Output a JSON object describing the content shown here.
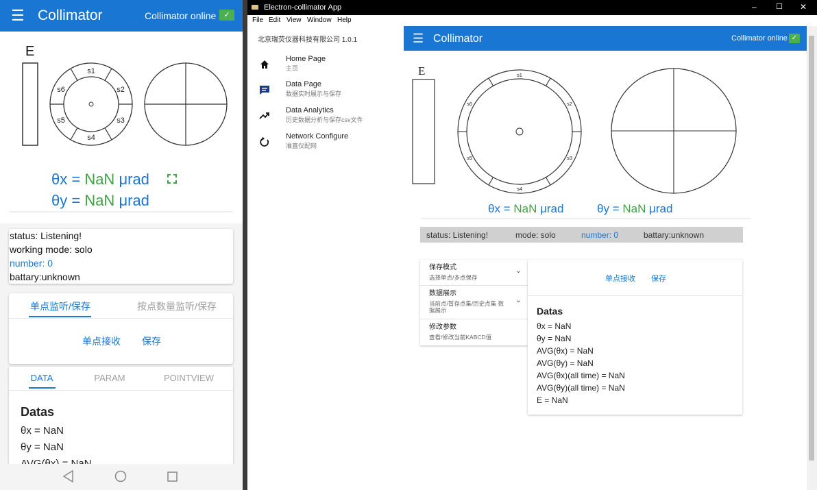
{
  "phone": {
    "appbar": {
      "title": "Collimator",
      "online_label": "Collimator online",
      "check": "✓"
    },
    "diagram": {
      "e_label": "E",
      "sectors": [
        "s1",
        "s2",
        "s3",
        "s4",
        "s5",
        "s6"
      ]
    },
    "theta_x": {
      "label": "θx = ",
      "value": "NaN",
      "unit": " μrad"
    },
    "theta_y": {
      "label": "θy = ",
      "value": "NaN",
      "unit": " μrad"
    },
    "status": {
      "status": "status: Listening!",
      "mode": "working mode: solo",
      "number": "number: 0",
      "battery": "battary:unknown"
    },
    "tabs1": {
      "labels": [
        "单点监听/保存",
        "按点数量监听/保存"
      ],
      "actions": [
        "单点接收",
        "保存"
      ]
    },
    "tabs2": {
      "labels": [
        "DATA",
        "PARAM",
        "POINTVIEW"
      ]
    },
    "datas": {
      "title": "Datas",
      "lines": [
        "θx = NaN",
        "θy = NaN",
        "AVG(θx) = NaN"
      ]
    }
  },
  "window": {
    "title": "Electron-collimator App",
    "controls": [
      "–",
      "☐",
      "✕"
    ],
    "menu": [
      "File",
      "Edit",
      "View",
      "Window",
      "Help"
    ],
    "drawer": {
      "company": "北京瑞荧仪器科技有限公司 1.0.1",
      "items": [
        {
          "icon": "home-icon",
          "glyph": "⌂",
          "label": "Home Page",
          "sub": "主页"
        },
        {
          "icon": "chat-icon",
          "glyph": "▬",
          "label": "Data Page",
          "sub": "数据实时展示与保存"
        },
        {
          "icon": "trending-up-icon",
          "glyph": "↗",
          "label": "Data Analytics",
          "sub": "历史数据分析与保存csv文件"
        },
        {
          "icon": "refresh-icon",
          "glyph": "↻",
          "label": "Network Configure",
          "sub": "准直仪配网"
        }
      ],
      "active_index": 1
    },
    "appbar": {
      "title": "Collimator",
      "online_label": "Collimator online",
      "check": "✓"
    },
    "diagram": {
      "e_label": "E",
      "sectors": [
        "s1",
        "s2",
        "s3",
        "s4",
        "s5",
        "s6"
      ]
    },
    "theta_x": {
      "label": "θx = ",
      "value": "NaN",
      "unit": " μrad"
    },
    "theta_y": {
      "label": "θy = ",
      "value": "NaN",
      "unit": " μrad"
    },
    "status": {
      "status": "status: Listening!",
      "mode": "mode: solo",
      "number": "number: 0",
      "battery": "battary:unknown"
    },
    "panels": [
      {
        "title": "保存模式",
        "sub": "选择单点/多点保存",
        "chevron": "⌄"
      },
      {
        "title": "数据展示",
        "sub": "当前点/暂存点集/历史点集 数据展示",
        "chevron": "⌄"
      },
      {
        "title": "修改参数",
        "sub": "查看/修改当前KABCD值"
      }
    ],
    "actions": [
      "单点接收",
      "保存"
    ],
    "datas": {
      "title": "Datas",
      "lines": [
        "θx = NaN",
        "θy = NaN",
        "AVG(θx) = NaN",
        "AVG(θy) = NaN",
        "AVG(θx)(all time) = NaN",
        "AVG(θy)(all time) = NaN",
        "E = NaN"
      ]
    }
  },
  "colors": {
    "primary": "#1976d2",
    "value_green": "#43a047",
    "online_green": "#4caf50"
  }
}
